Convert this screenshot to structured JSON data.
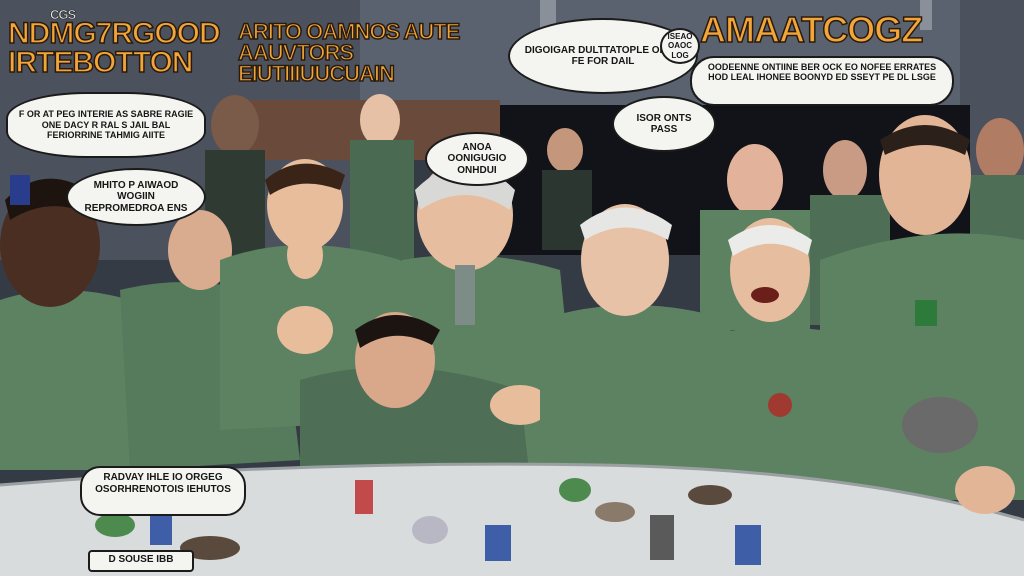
{
  "titles": {
    "left": "NDMG7RGOOD IRTEBOTTON",
    "left_small": "CGS",
    "center": "ARITO OAMNOS AUTE AAUVTORS EIUTIIIUUCUAIN",
    "right": "AMAATCOGZ"
  },
  "bubbles": {
    "top_left": "F OR AT PEG INTERIE AS SABRE RAGIE ONE DACY R RAL S JAIL BAL FERIORRINE TAHMIG AIITE",
    "mid_left": "MHITO P AIWAOD WOGIIN REPROMEDROA ENS",
    "center_cap": "ANOA OONIGUGIO ONHDUI",
    "top_center": "DIGOIGAR DULTTATOPLE OF ET FE FOR DAIL",
    "top_center_small": "ISEAO OAOC LOG",
    "mid_right": "ISOR ONTS PASS",
    "right_caption": "OODEENNE ONTIINE BER OCK EO NOFEE ERRATES HOD LEAL IHONEE BOONYD ED SSEYT PE DL LSGE",
    "bottom_left": "RADVAY IHLE IO ORGEG OSORHRENOTOIS IEHUTOS",
    "bottom_corner": "D SOUSE IBB"
  },
  "colors": {
    "uniform": "#5d8262",
    "uniform_shadow": "#3f5c45",
    "table": "#d8dcdc",
    "wall": "#3e4450",
    "title": "#f2a63a"
  }
}
